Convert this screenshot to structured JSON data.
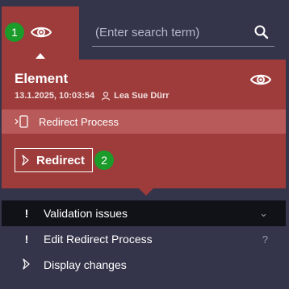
{
  "badges": {
    "first": "1",
    "second": "2"
  },
  "search": {
    "placeholder": "(Enter search term)"
  },
  "element": {
    "title": "Element",
    "datetime": "13.1.2025, 10:03:54",
    "user": "Lea Sue Dürr"
  },
  "process": {
    "label": "Redirect Process"
  },
  "action": {
    "redirect_label": "Redirect"
  },
  "list": {
    "items": [
      {
        "label": "Validation issues",
        "lead": "!",
        "trail": "⌄"
      },
      {
        "label": "Edit Redirect Process",
        "lead": "!",
        "trail": "?"
      },
      {
        "label": "Display changes",
        "lead": "❯",
        "trail": ""
      }
    ]
  },
  "colors": {
    "panel": "#9e3b3b",
    "panel_highlight": "#b95a5a",
    "background": "#34344a",
    "badge": "#1a9b2a",
    "list_selected": "#111118"
  },
  "icons": {
    "eye": "eye-icon",
    "search": "search-icon",
    "user": "user-icon",
    "document_redirect": "document-redirect-icon",
    "chevron_right": "chevron-right-icon",
    "chevron_down": "chevron-down-icon",
    "help": "help-icon",
    "warning": "exclamation-icon"
  }
}
